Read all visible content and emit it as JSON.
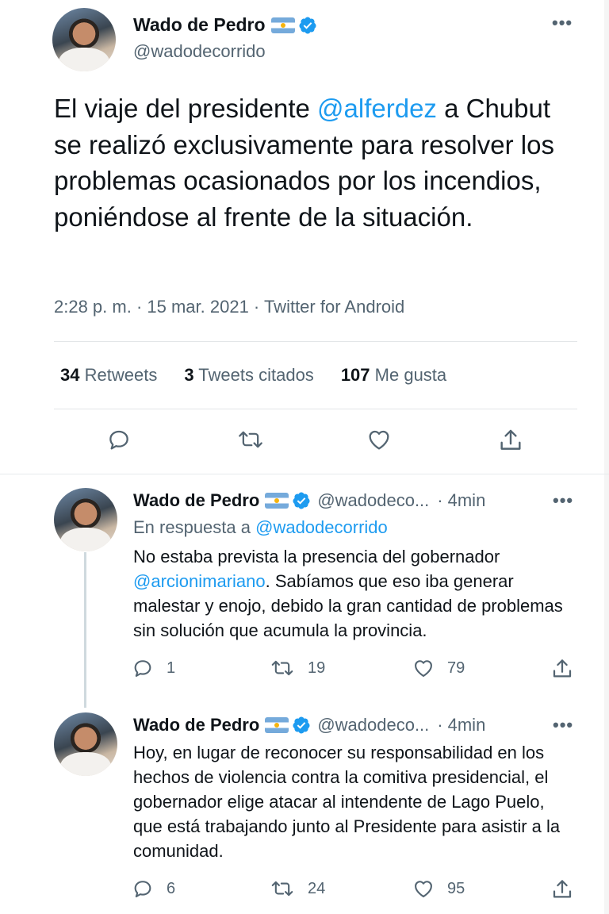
{
  "main_tweet": {
    "author_name": "Wado de Pedro",
    "author_handle": "@wadodecorrido",
    "text_before_mention": "El viaje del presidente ",
    "mention": "@alferdez",
    "text_after_mention": " a Chubut se realizó exclusivamente para resolver los problemas ocasionados por los incendios, poniéndose al frente de la situación.",
    "meta": "2:28 p. m. · 15 mar. 2021 · Twitter for Android",
    "stats": {
      "retweets_count": "34",
      "retweets_label": "Retweets",
      "quotes_count": "3",
      "quotes_label": "Tweets citados",
      "likes_count": "107",
      "likes_label": "Me gusta"
    },
    "more_label": "•••"
  },
  "replies": [
    {
      "author_name": "Wado de Pedro",
      "author_handle": "@wadodeco...",
      "separator": "·",
      "time": "4min",
      "in_reply_prefix": "En respuesta a ",
      "in_reply_handle": "@wadodecorrido",
      "text_before_mention": "No estaba prevista la presencia del gobernador ",
      "mention": "@arcionimariano",
      "text_after_mention": ". Sabíamos que eso iba generar malestar y enojo, debido la gran cantidad de problemas sin solución que acumula la provincia.",
      "replies_count": "1",
      "retweets_count": "19",
      "likes_count": "79",
      "more_label": "•••"
    },
    {
      "author_name": "Wado de Pedro",
      "author_handle": "@wadodeco...",
      "separator": "·",
      "time": "4min",
      "text": "Hoy, en lugar de reconocer su responsabilidad en los hechos de violencia contra la comitiva presidencial, el gobernador elige atacar al intendente de Lago Puelo, que está trabajando junto al Presidente para asistir a la comunidad.",
      "replies_count": "6",
      "retweets_count": "24",
      "likes_count": "95",
      "more_label": "•••"
    }
  ],
  "icons": [
    "reply-icon",
    "retweet-icon",
    "like-icon",
    "share-icon",
    "verified-icon",
    "argentina-flag-icon",
    "more-icon"
  ],
  "colors": {
    "link": "#1d9bf0",
    "muted": "#536471",
    "text": "#0f1419",
    "verified": "#1d9bf0",
    "flag_blue": "#75aadb"
  }
}
